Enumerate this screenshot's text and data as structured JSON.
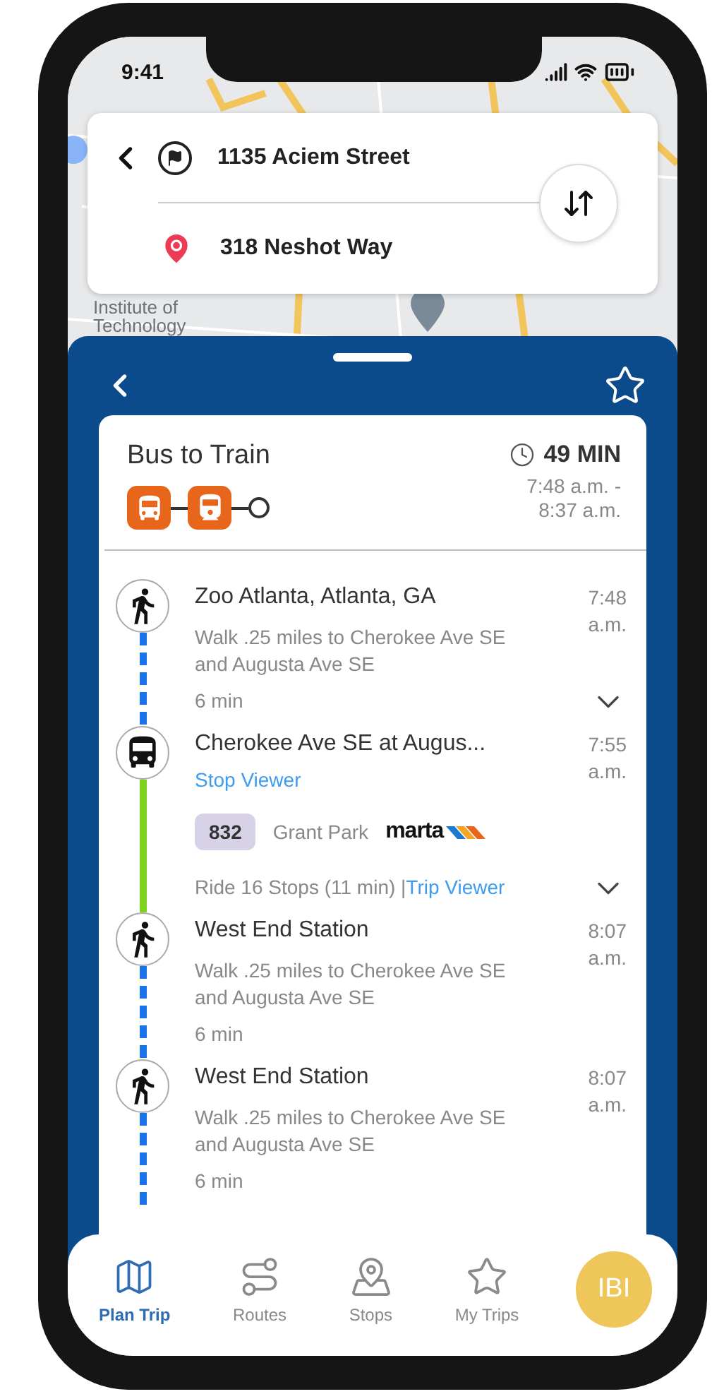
{
  "status_bar": {
    "time": "9:41"
  },
  "trip_search": {
    "origin": "1135 Aciem Street",
    "destination": "318 Neshot Way"
  },
  "map": {
    "label": "Institute of Technology"
  },
  "itinerary": {
    "title": "Bus to Train",
    "duration": "49 MIN",
    "times": "7:48 a.m. - 8:37 a.m.",
    "modes": [
      {
        "kind": "bus"
      },
      {
        "kind": "train"
      },
      {
        "kind": "end"
      }
    ]
  },
  "legs": [
    {
      "kind": "walk",
      "place": "Zoo Atlanta, Atlanta, GA",
      "time": "7:48 a.m.",
      "detail": "Walk .25 miles to Cherokee Ave SE and Augusta Ave SE",
      "duration": "6 min",
      "toggle": {
        "expanded": false
      }
    },
    {
      "kind": "bus",
      "place": "Cherokee Ave SE at Augus...",
      "time": "7:55 a.m.",
      "link": "Stop Viewer",
      "route": {
        "number": "832",
        "name": "Grant Park",
        "agency": "marta"
      },
      "ride": "Ride 16 Stops (11 min) |",
      "ride_link": "Trip Viewer",
      "toggle": {
        "expanded": false
      }
    },
    {
      "kind": "walk",
      "place": "West End Station",
      "time": "8:07 a.m.",
      "detail": "Walk .25 miles to Cherokee Ave SE and Augusta Ave SE",
      "duration": "6 min"
    },
    {
      "kind": "walk",
      "place": "West End Station",
      "time": "8:07 a.m.",
      "detail": "Walk .25 miles to Cherokee Ave SE and Augusta Ave SE",
      "duration": "6 min"
    }
  ],
  "tabs": [
    {
      "kind": "map",
      "label": "Plan Trip",
      "selected": true
    },
    {
      "kind": "routes",
      "label": "Routes",
      "selected": false
    },
    {
      "kind": "stops",
      "label": "Stops",
      "selected": false
    },
    {
      "kind": "trips",
      "label": "My Trips",
      "selected": false
    }
  ],
  "avatar": {
    "initials": "IBI"
  }
}
